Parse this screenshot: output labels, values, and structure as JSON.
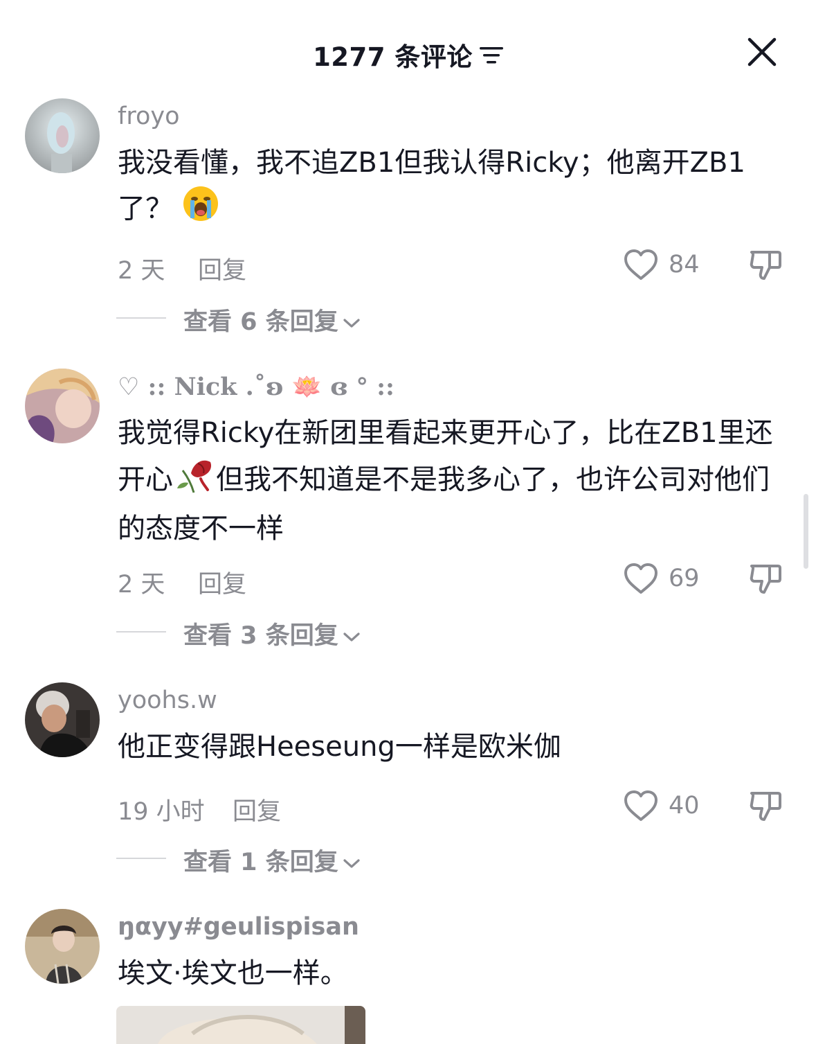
{
  "header": {
    "title": "1277 条评论",
    "filter_icon": "filter-lines-icon",
    "close_icon": "close-icon"
  },
  "comments": [
    {
      "username": "froyo",
      "text": "我没看懂，我不追ZB1但我认得Ricky；他离开ZB1了？",
      "emoji": "loudly-crying-face",
      "time": "2 天",
      "reply_label": "回复",
      "likes": "84",
      "view_replies": "查看 6 条回复"
    },
    {
      "username": "♡ :: Nick .˚ʚ 🪷 ɞ ° ::",
      "text": "我觉得Ricky在新团里看起来更开心了，比在ZB1里还开心",
      "emoji": "wilted-rose",
      "text_after_emoji": "但我不知道是不是我多心了，也许公司对他们的态度不一样",
      "time": "2 天",
      "reply_label": "回复",
      "likes": "69",
      "view_replies": "查看 3 条回复"
    },
    {
      "username": "yoohs.w",
      "text": "他正变得跟Heeseung一样是欧米伽",
      "time": "19 小时",
      "reply_label": "回复",
      "likes": "40",
      "view_replies": "查看 1 条回复"
    },
    {
      "username": "ŋαyy#geulispisan",
      "text": "埃文·埃文也一样。"
    }
  ],
  "colors": {
    "text_primary": "#161823",
    "text_secondary": "#8a8b91",
    "divider": "#d6d7da"
  }
}
